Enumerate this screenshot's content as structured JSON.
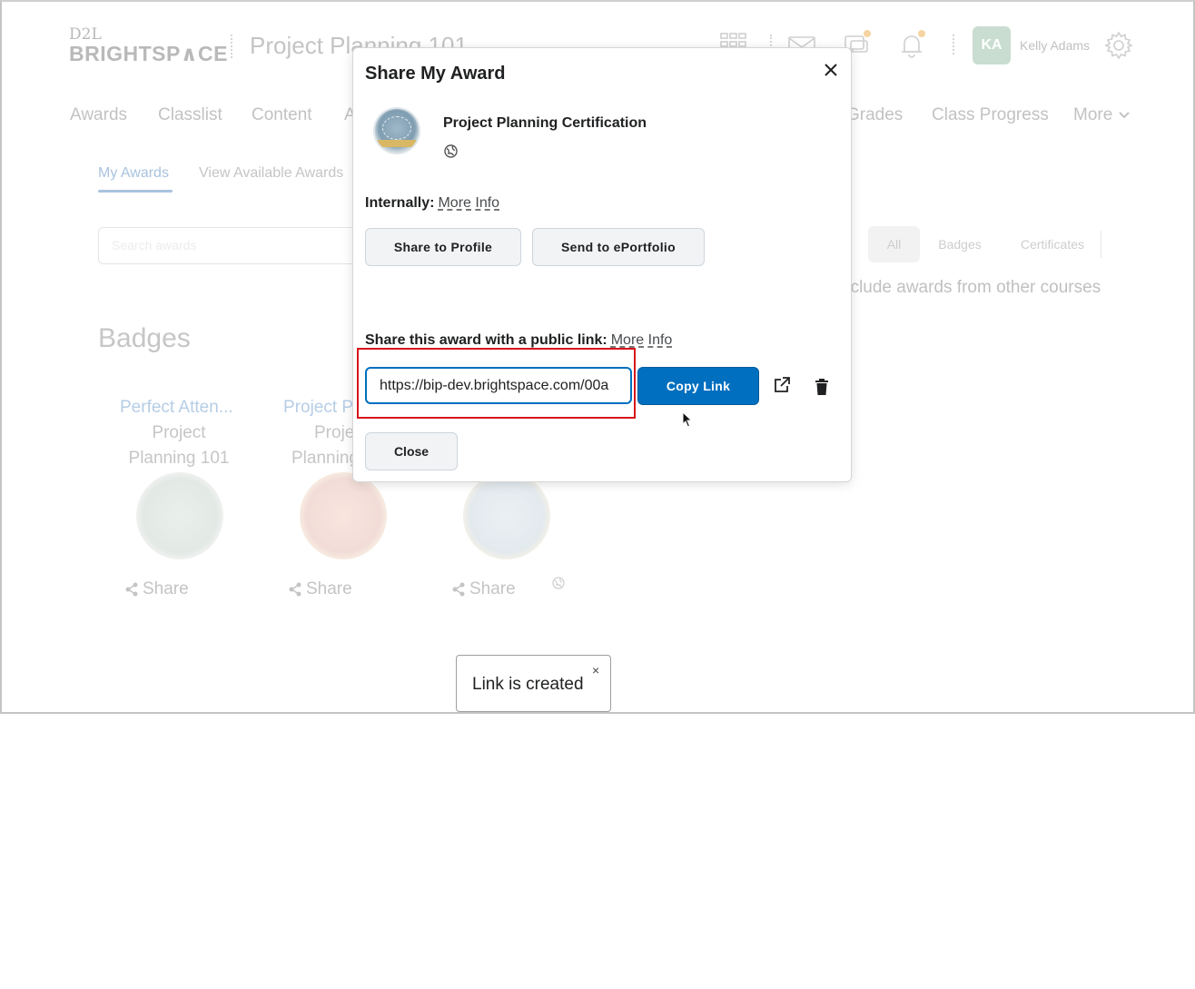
{
  "header": {
    "logo_top": "D2L",
    "logo_main": "BRIGHTSP∧CE",
    "course_title": "Project Planning 101",
    "avatar_initials": "KA",
    "user_name": "Kelly Adams"
  },
  "nav": {
    "items": [
      "Awards",
      "Classlist",
      "Content",
      "A",
      "Grades",
      "Class Progress",
      "More"
    ]
  },
  "subtabs": {
    "my_awards": "My Awards",
    "view_available": "View Available Awards"
  },
  "search": {
    "placeholder": "Search awards"
  },
  "filters": {
    "all": "All",
    "badges": "Badges",
    "certificates": "Certificates"
  },
  "include_text": "nclude awards from other courses",
  "section_title": "Badges",
  "badges": [
    {
      "name": "Perfect Atten...",
      "course_line1": "Project",
      "course_line2": "Planning 101",
      "share": "Share"
    },
    {
      "name": "Project P",
      "course_line1": "Proje",
      "course_line2": "Planning",
      "share": "Share"
    },
    {
      "name": "",
      "course_line1": "",
      "course_line2": "",
      "share": "Share"
    }
  ],
  "dialog": {
    "title": "Share My Award",
    "award_title": "Project Planning Certification",
    "internally_label": "Internally:",
    "more_info": "More Info",
    "share_to_profile": "Share to Profile",
    "send_to_eportfolio": "Send to ePortfolio",
    "public_link_label": "Share this award with a public link:",
    "link_value": "https://bip-dev.brightspace.com/00a",
    "copy_link": "Copy Link",
    "close": "Close"
  },
  "toast": {
    "text": "Link is created",
    "close": "×"
  },
  "colors": {
    "primary": "#006fbf",
    "highlight": "#d7141a",
    "faded_link": "#b6cde6"
  }
}
